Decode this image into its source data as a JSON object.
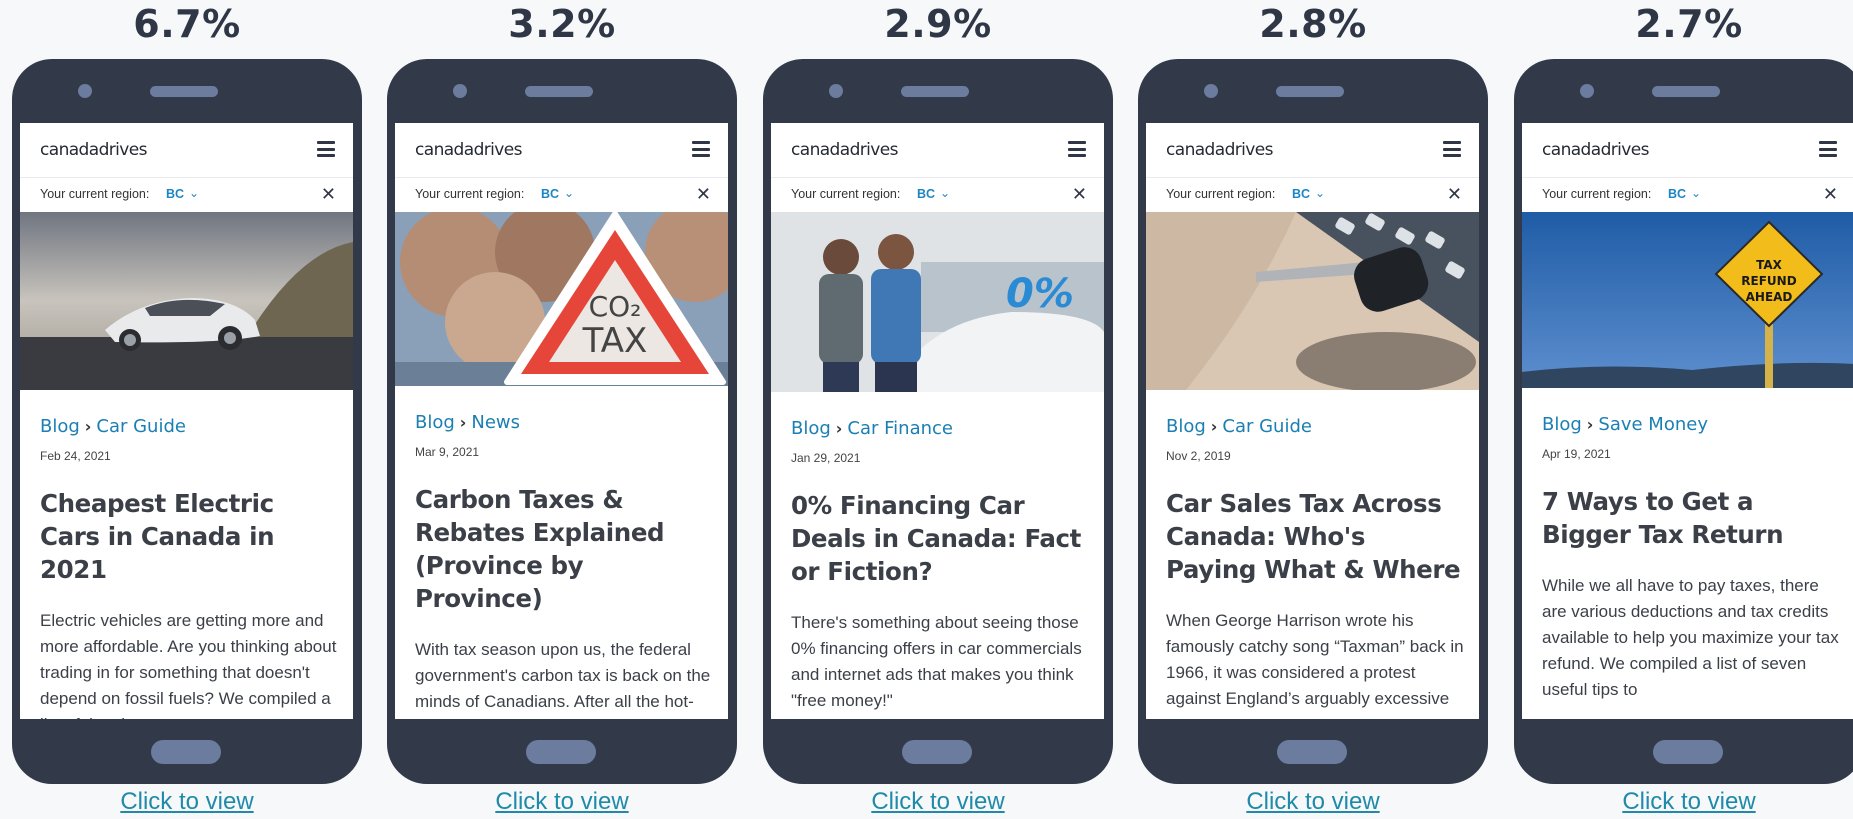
{
  "colors": {
    "phone_body": "#323a4a",
    "accent_link": "#1a7fb3",
    "cta_link": "#1f8aaa",
    "heading": "#2f3747"
  },
  "logo_text": "canadadrives",
  "menu_icon": "hamburger-menu-icon",
  "close_icon": "close-x-icon",
  "region_label": "Your current region:",
  "region_value": "BC",
  "cta_label": "Click to view",
  "variants": [
    {
      "percent": "6.7%",
      "crumb_root": "Blog",
      "crumb_category": "Car Guide",
      "date": "Feb 24, 2021",
      "title": "Cheapest Electric Cars in Canada in 2021",
      "excerpt": "Electric vehicles are getting more and more affordable. Are you thinking about trading in for something that doesn't depend on fossil fuels? We compiled a list of the cheapest",
      "hero": "white-electric-car-photo"
    },
    {
      "percent": "3.2%",
      "crumb_root": "Blog",
      "crumb_category": "News",
      "date": "Mar 9, 2021",
      "title": "Carbon Taxes & Rebates Explained (Province by Province)",
      "excerpt": "With tax season upon us, the federal government's carbon tax is back on the minds of Canadians. After all the hot-button chatter about carbon",
      "hero": "co2-tax-sign-photo",
      "hero_sign_top": "CO₂",
      "hero_sign_bottom": "TAX"
    },
    {
      "percent": "2.9%",
      "crumb_root": "Blog",
      "crumb_category": "Car Finance",
      "date": "Jan 29, 2021",
      "title": "0% Financing Car Deals in Canada: Fact or Fiction?",
      "excerpt": "There's something about seeing those 0% financing offers in car commercials and internet ads that makes you think \"free money!\"",
      "hero": "couple-with-car-photo",
      "hero_overlay": "0%"
    },
    {
      "percent": "2.8%",
      "crumb_root": "Blog",
      "crumb_category": "Car Guide",
      "date": "Nov 2, 2019",
      "title": "Car Sales Tax Across Canada: Who's Paying What & Where",
      "excerpt": "When George Harrison wrote his famously catchy song “Taxman” back in 1966, it was considered a protest against England’s arguably excessive",
      "hero": "car-key-and-calculator-photo"
    },
    {
      "percent": "2.7%",
      "crumb_root": "Blog",
      "crumb_category": "Save Money",
      "date": "Apr 19, 2021",
      "title": "7 Ways to Get a Bigger Tax Return",
      "excerpt": "While we all have to pay taxes, there are various deductions and tax credits available to help you maximize your tax refund. We compiled a list of seven useful tips to",
      "hero": "tax-refund-ahead-sign-photo",
      "hero_sign_lines": [
        "TAX",
        "REFUND",
        "AHEAD"
      ]
    }
  ]
}
